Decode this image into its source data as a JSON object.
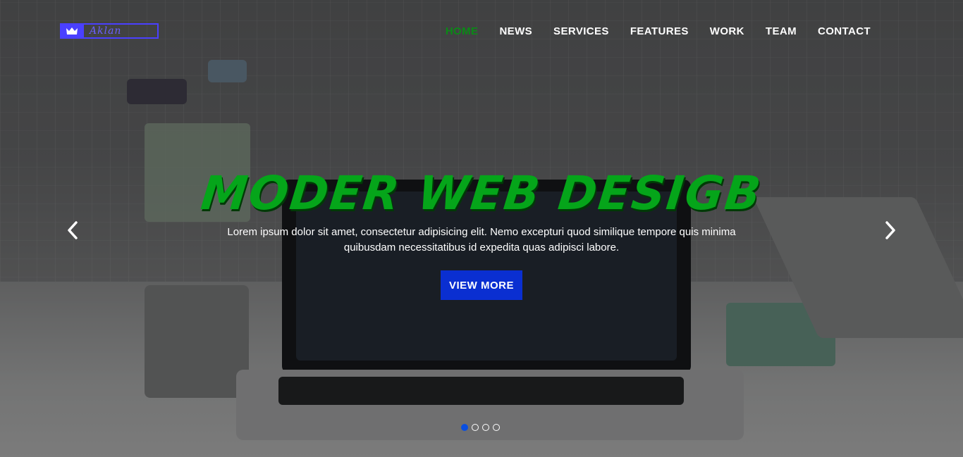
{
  "brand": {
    "logo_icon": "crown-icon",
    "logo_color": "#4a40ff"
  },
  "nav": {
    "items": [
      {
        "label": "HOME",
        "active": true
      },
      {
        "label": "NEWS"
      },
      {
        "label": "SERVICES"
      },
      {
        "label": "FEATURES"
      },
      {
        "label": "WORK"
      },
      {
        "label": "TEAM"
      },
      {
        "label": "CONTACT"
      }
    ],
    "active_color": "#0a8a16"
  },
  "hero": {
    "title": "MODER WEB DESIGB",
    "text": "Lorem ipsum dolor sit amet, consectetur adipisicing elit. Nemo excepturi quod similique tempore quis minima quibusdam necessitatibus id expedita quas adipisci labore.",
    "button_label": "VIEW MORE",
    "title_color": "#05a51a",
    "button_color": "#0a2fd1"
  },
  "carousel": {
    "prev_icon": "chevron-left-icon",
    "next_icon": "chevron-right-icon",
    "slide_count": 4,
    "active_slide": 1
  }
}
